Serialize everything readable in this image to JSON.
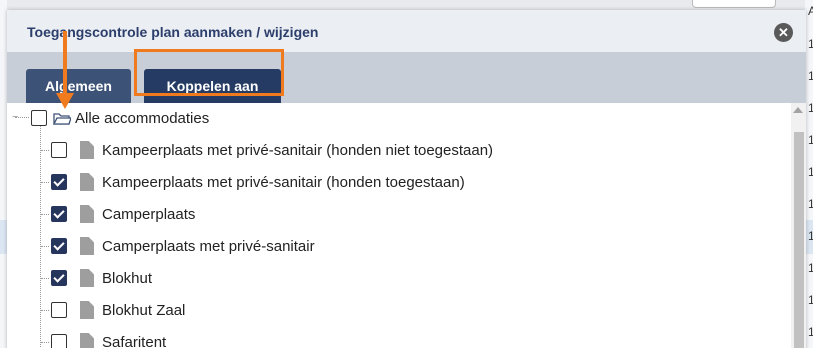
{
  "dialog": {
    "title": "Toegangscontrole plan aanmaken / wijzigen",
    "close_symbol": "✕"
  },
  "tabs": [
    {
      "label": "Algemeen"
    },
    {
      "label": "Koppelen aan"
    }
  ],
  "tree": {
    "root": {
      "label": "Alle accommodaties",
      "checked": false,
      "icon": "folder-icon"
    },
    "items": [
      {
        "label": "Kampeerplaats met privé-sanitair (honden niet toegestaan)",
        "checked": false
      },
      {
        "label": "Kampeerplaats met privé-sanitair (honden toegestaan)",
        "checked": true
      },
      {
        "label": "Camperplaats",
        "checked": true
      },
      {
        "label": "Camperplaats met privé-sanitair",
        "checked": true
      },
      {
        "label": "Blokhut",
        "checked": true
      },
      {
        "label": "Blokhut Zaal",
        "checked": false
      },
      {
        "label": "Safaritent",
        "checked": false
      }
    ]
  },
  "background": {
    "right_cells": [
      "A",
      "1",
      "1",
      "1",
      "1",
      "1",
      "1",
      "1",
      "1",
      "1",
      "1"
    ]
  },
  "colors": {
    "annotation": "#f07a1e",
    "tab_active": "#253b63",
    "tab_inactive": "#3d5277",
    "title_text": "#2c3e6b"
  }
}
